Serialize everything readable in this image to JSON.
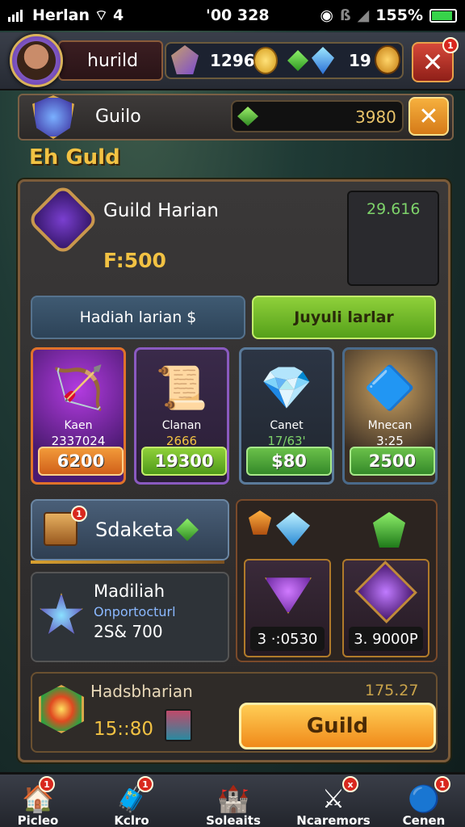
{
  "status": {
    "carrier": "Herlan",
    "time": "'00 328",
    "battery": "155%",
    "battery_level": 0.9
  },
  "top": {
    "player_name": "hurild",
    "res1_value": "1296",
    "res2_value": "19",
    "close_badge": "1"
  },
  "guild_bar": {
    "title": "Guilo",
    "gem_value": "3980"
  },
  "section_title": "Eh Guld",
  "panel": {
    "header_title": "Guild Harian",
    "header_value": "F:500",
    "side_value": "29.616",
    "tabs": [
      {
        "label": "Hadiah larian $"
      },
      {
        "label": "Juyuli larlar"
      }
    ],
    "cards": [
      {
        "name": "Kaen",
        "sub": "2337024",
        "price": "6200",
        "icon": "bow-icon",
        "glyph": "🏹"
      },
      {
        "name": "Clanan",
        "sub": "2666",
        "price": "19300",
        "icon": "scroll-icon",
        "glyph": "📜"
      },
      {
        "name": "Canet",
        "sub": "17/63'",
        "price": "$80",
        "icon": "crystal-icon",
        "glyph": "💎"
      },
      {
        "name": "Mnecan",
        "sub": "3:25",
        "price": "2500",
        "icon": "gem-shield-icon",
        "glyph": "🔷"
      }
    ],
    "sdaketa_label": "Sdaketa",
    "sdaketa_badge": "1",
    "info": {
      "title": "Madiliah",
      "sub": "Onportocturl",
      "value": "2S& 700"
    },
    "mini_cards": [
      {
        "price": "3 ·:0530"
      },
      {
        "price": "3. 9000P"
      }
    ],
    "daily": {
      "title": "Hadsbharian",
      "value": "175.27",
      "timer": "15::80",
      "button": "Guild"
    }
  },
  "bottom_nav": [
    {
      "label": "Picleo",
      "badge": "1",
      "icon": "house-icon",
      "glyph": "🏠"
    },
    {
      "label": "Kclro",
      "badge": "1",
      "icon": "chest-icon",
      "glyph": "🧳"
    },
    {
      "label": "Soleaits",
      "badge": "",
      "icon": "castle-icon",
      "glyph": "🏰"
    },
    {
      "label": "Ncaremors",
      "badge": "x",
      "icon": "sword-icon",
      "glyph": "⚔"
    },
    {
      "label": "Cenen",
      "badge": "1",
      "icon": "orb-icon",
      "glyph": "🔵"
    }
  ],
  "colors": {
    "gold": "#f2c243",
    "green_btn": "#55a01a",
    "orange_btn": "#f08a1a",
    "red_btn": "#d6483a"
  }
}
